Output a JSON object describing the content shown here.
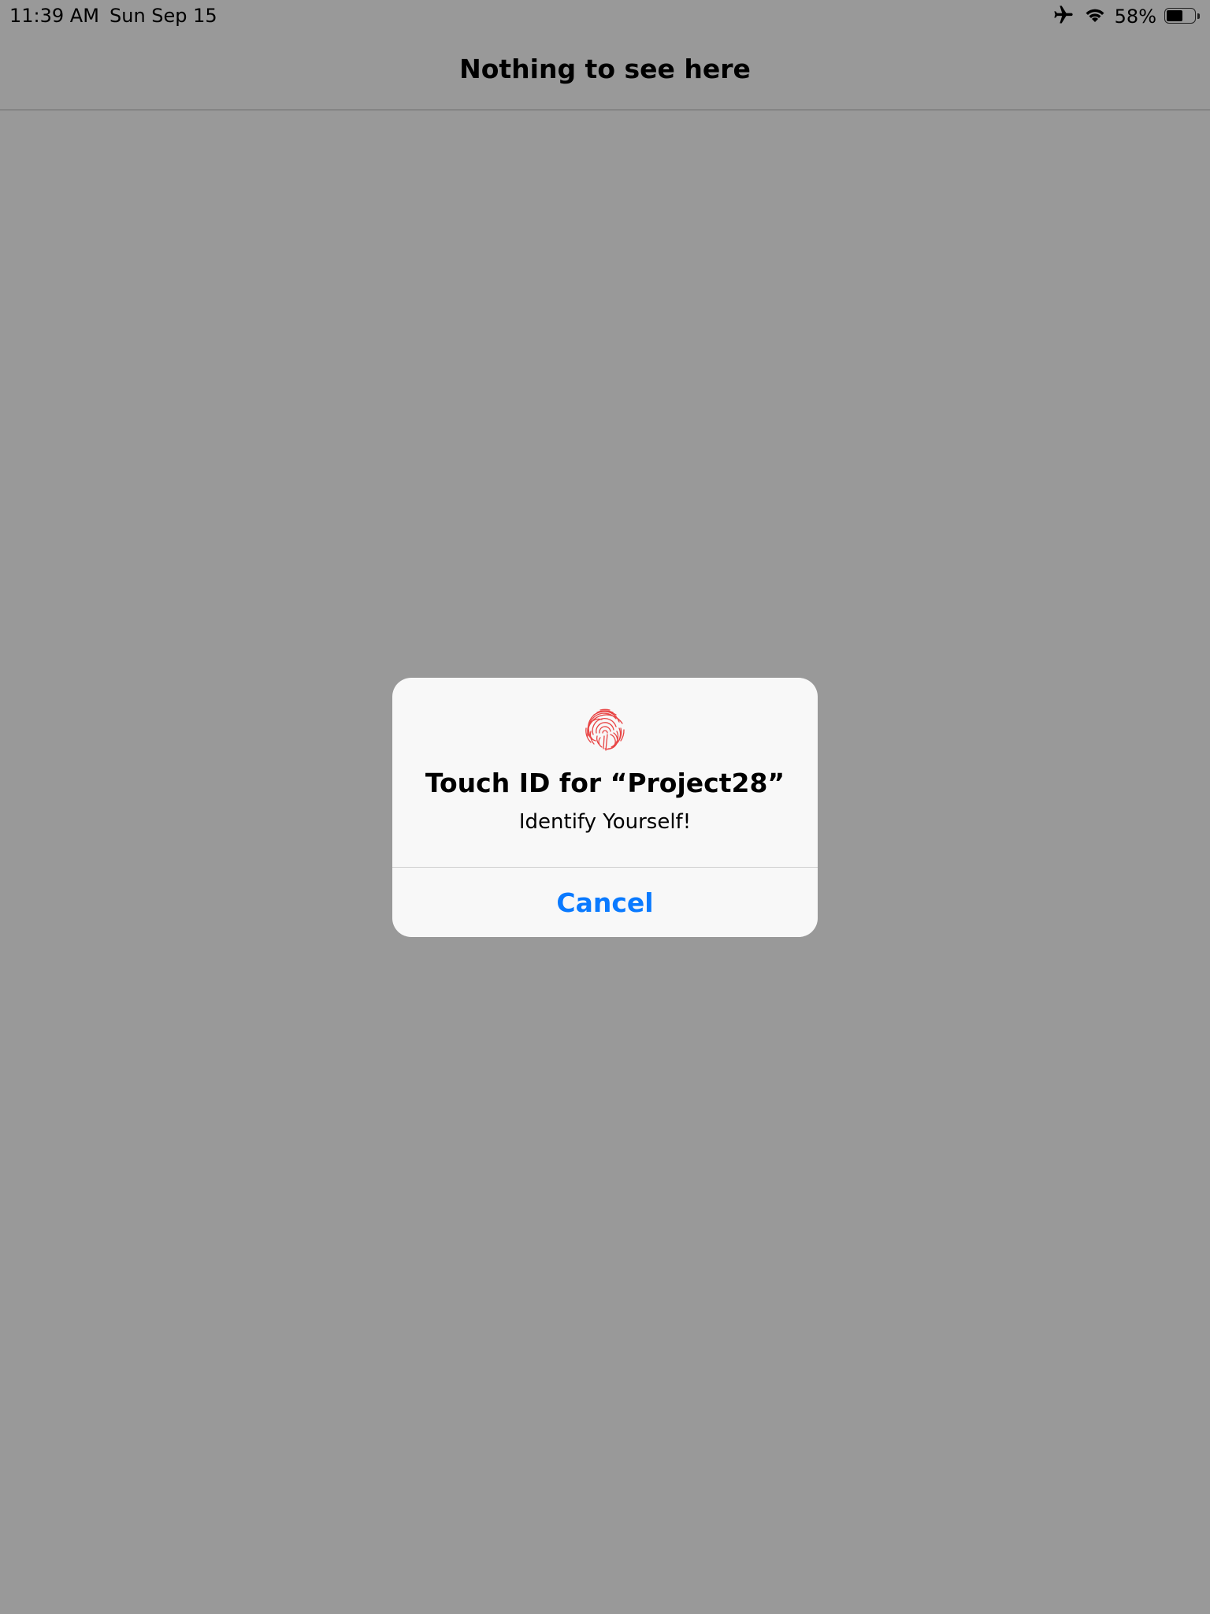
{
  "status_bar": {
    "time": "11:39 AM",
    "date": "Sun Sep 15",
    "battery_percent_label": "58%",
    "battery_level": 0.58,
    "icons": [
      "airplane-icon",
      "wifi-icon",
      "battery-icon"
    ]
  },
  "nav_bar": {
    "title": "Nothing to see here"
  },
  "alert": {
    "icon": "fingerprint-icon",
    "title": "Touch ID for “Project28”",
    "message": "Identify Yourself!",
    "cancel_label": "Cancel"
  },
  "colors": {
    "background": "#999999",
    "alert_background": "#f8f8f8",
    "accent": "#0a7aff",
    "fingerprint": "#e84545"
  }
}
